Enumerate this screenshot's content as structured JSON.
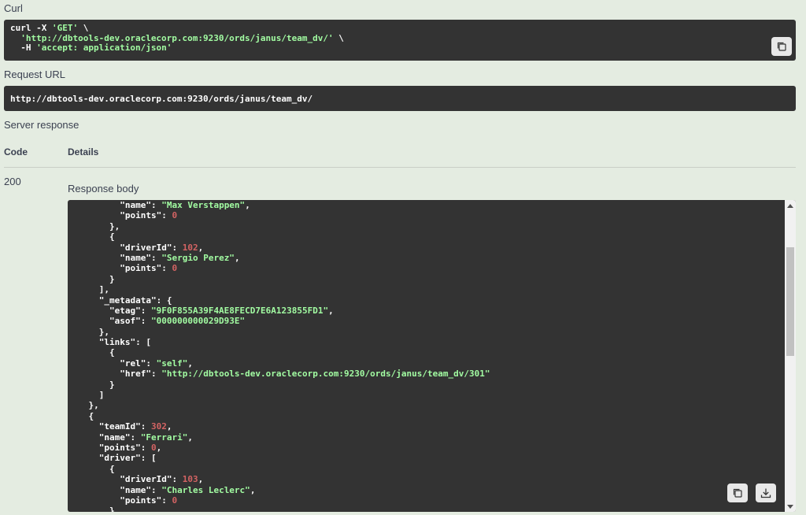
{
  "labels": {
    "curl": "Curl",
    "request_url": "Request URL",
    "server_response": "Server response",
    "code_header": "Code",
    "details_header": "Details",
    "response_body": "Response body"
  },
  "curl": {
    "lines": [
      [
        {
          "t": "curl -X ",
          "c": "w"
        },
        {
          "t": "'GET'",
          "c": "s"
        },
        {
          "t": " \\",
          "c": "w"
        }
      ],
      [
        {
          "t": "  ",
          "c": "w"
        },
        {
          "t": "'http://dbtools-dev.oraclecorp.com:9230/ords/janus/team_dv/'",
          "c": "s"
        },
        {
          "t": " \\",
          "c": "w"
        }
      ],
      [
        {
          "t": "  -H ",
          "c": "w"
        },
        {
          "t": "'accept: application/json'",
          "c": "s"
        }
      ]
    ]
  },
  "request_url": "http://dbtools-dev.oraclecorp.com:9230/ords/janus/team_dv/",
  "response": {
    "code": "200",
    "body_lines": [
      [
        {
          "t": "          \"name\": ",
          "c": "w"
        },
        {
          "t": "\"Max Verstappen\"",
          "c": "s"
        },
        {
          "t": ",",
          "c": "w"
        }
      ],
      [
        {
          "t": "          \"points\": ",
          "c": "w"
        },
        {
          "t": "0",
          "c": "n"
        }
      ],
      [
        {
          "t": "        },",
          "c": "w"
        }
      ],
      [
        {
          "t": "        {",
          "c": "w"
        }
      ],
      [
        {
          "t": "          \"driverId\": ",
          "c": "w"
        },
        {
          "t": "102",
          "c": "n"
        },
        {
          "t": ",",
          "c": "w"
        }
      ],
      [
        {
          "t": "          \"name\": ",
          "c": "w"
        },
        {
          "t": "\"Sergio Perez\"",
          "c": "s"
        },
        {
          "t": ",",
          "c": "w"
        }
      ],
      [
        {
          "t": "          \"points\": ",
          "c": "w"
        },
        {
          "t": "0",
          "c": "n"
        }
      ],
      [
        {
          "t": "        }",
          "c": "w"
        }
      ],
      [
        {
          "t": "      ],",
          "c": "w"
        }
      ],
      [
        {
          "t": "      \"_metadata\": {",
          "c": "w"
        }
      ],
      [
        {
          "t": "        \"etag\": ",
          "c": "w"
        },
        {
          "t": "\"9F0F855A39F4AE8FECD7E6A123855FD1\"",
          "c": "s"
        },
        {
          "t": ",",
          "c": "w"
        }
      ],
      [
        {
          "t": "        \"asof\": ",
          "c": "w"
        },
        {
          "t": "\"000000000029D93E\"",
          "c": "s"
        }
      ],
      [
        {
          "t": "      },",
          "c": "w"
        }
      ],
      [
        {
          "t": "      \"links\": [",
          "c": "w"
        }
      ],
      [
        {
          "t": "        {",
          "c": "w"
        }
      ],
      [
        {
          "t": "          \"rel\": ",
          "c": "w"
        },
        {
          "t": "\"self\"",
          "c": "s"
        },
        {
          "t": ",",
          "c": "w"
        }
      ],
      [
        {
          "t": "          \"href\": ",
          "c": "w"
        },
        {
          "t": "\"http://dbtools-dev.oraclecorp.com:9230/ords/janus/team_dv/301\"",
          "c": "s"
        }
      ],
      [
        {
          "t": "        }",
          "c": "w"
        }
      ],
      [
        {
          "t": "      ]",
          "c": "w"
        }
      ],
      [
        {
          "t": "    },",
          "c": "w"
        }
      ],
      [
        {
          "t": "    {",
          "c": "w"
        }
      ],
      [
        {
          "t": "      \"teamId\": ",
          "c": "w"
        },
        {
          "t": "302",
          "c": "n"
        },
        {
          "t": ",",
          "c": "w"
        }
      ],
      [
        {
          "t": "      \"name\": ",
          "c": "w"
        },
        {
          "t": "\"Ferrari\"",
          "c": "s"
        },
        {
          "t": ",",
          "c": "w"
        }
      ],
      [
        {
          "t": "      \"points\": ",
          "c": "w"
        },
        {
          "t": "0",
          "c": "n"
        },
        {
          "t": ",",
          "c": "w"
        }
      ],
      [
        {
          "t": "      \"driver\": [",
          "c": "w"
        }
      ],
      [
        {
          "t": "        {",
          "c": "w"
        }
      ],
      [
        {
          "t": "          \"driverId\": ",
          "c": "w"
        },
        {
          "t": "103",
          "c": "n"
        },
        {
          "t": ",",
          "c": "w"
        }
      ],
      [
        {
          "t": "          \"name\": ",
          "c": "w"
        },
        {
          "t": "\"Charles Leclerc\"",
          "c": "s"
        },
        {
          "t": ",",
          "c": "w"
        }
      ],
      [
        {
          "t": "          \"points\": ",
          "c": "w"
        },
        {
          "t": "0",
          "c": "n"
        }
      ],
      [
        {
          "t": "        }",
          "c": "w"
        }
      ]
    ]
  },
  "icons": {
    "copy": "copy-icon",
    "download": "download-icon"
  },
  "colors": {
    "background": "#e4ece1",
    "code_background": "#333333",
    "string": "#a2fca2",
    "number": "#d36363"
  }
}
